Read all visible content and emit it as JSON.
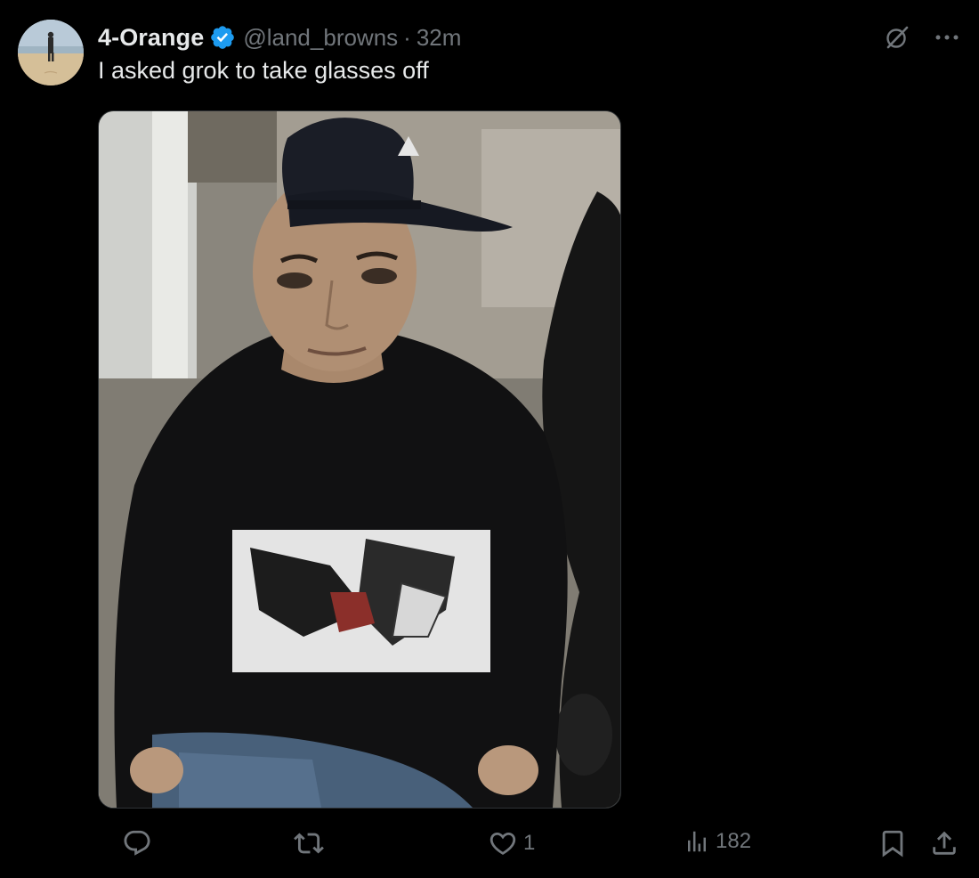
{
  "tweet": {
    "display_name": "4-Orange",
    "handle": "@land_browns",
    "separator": "·",
    "timestamp": "32m",
    "text": "I asked grok to take glasses off",
    "verified": true
  },
  "icons": {
    "avatar": "avatar-beach-photo",
    "verified": "verified-badge-icon",
    "grok": "grok-icon",
    "more": "more-icon",
    "reply": "reply-icon",
    "retweet": "retweet-icon",
    "like": "heart-icon",
    "views": "views-icon",
    "bookmark": "bookmark-icon",
    "share": "share-icon"
  },
  "media": {
    "description_type": "photo"
  },
  "actions": {
    "reply_count": "",
    "retweet_count": "",
    "like_count": "1",
    "views_count": "182"
  },
  "colors": {
    "background": "#000000",
    "primary_text": "#e7e9ea",
    "secondary_text": "#71767b",
    "verified_blue": "#1d9bf0"
  }
}
